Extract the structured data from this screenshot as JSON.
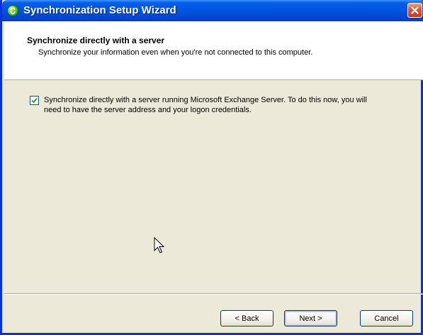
{
  "window": {
    "title": "Synchronization Setup Wizard",
    "icon": "sync-wizard-icon",
    "close_icon": "close-icon"
  },
  "header": {
    "title": "Synchronize directly with a server",
    "subtitle": "Synchronize your information even when you're not connected to this computer."
  },
  "option": {
    "checked": true,
    "label": "Synchronize directly with a server running Microsoft Exchange Server.  To do this now, you will need to have the server address and your logon credentials."
  },
  "buttons": {
    "back": "< Back",
    "next": "Next >",
    "cancel": "Cancel"
  },
  "colors": {
    "titlebar": "#0054e3",
    "frame": "#0831d9",
    "close": "#e2573a",
    "dialog_bg": "#ece9d8"
  }
}
